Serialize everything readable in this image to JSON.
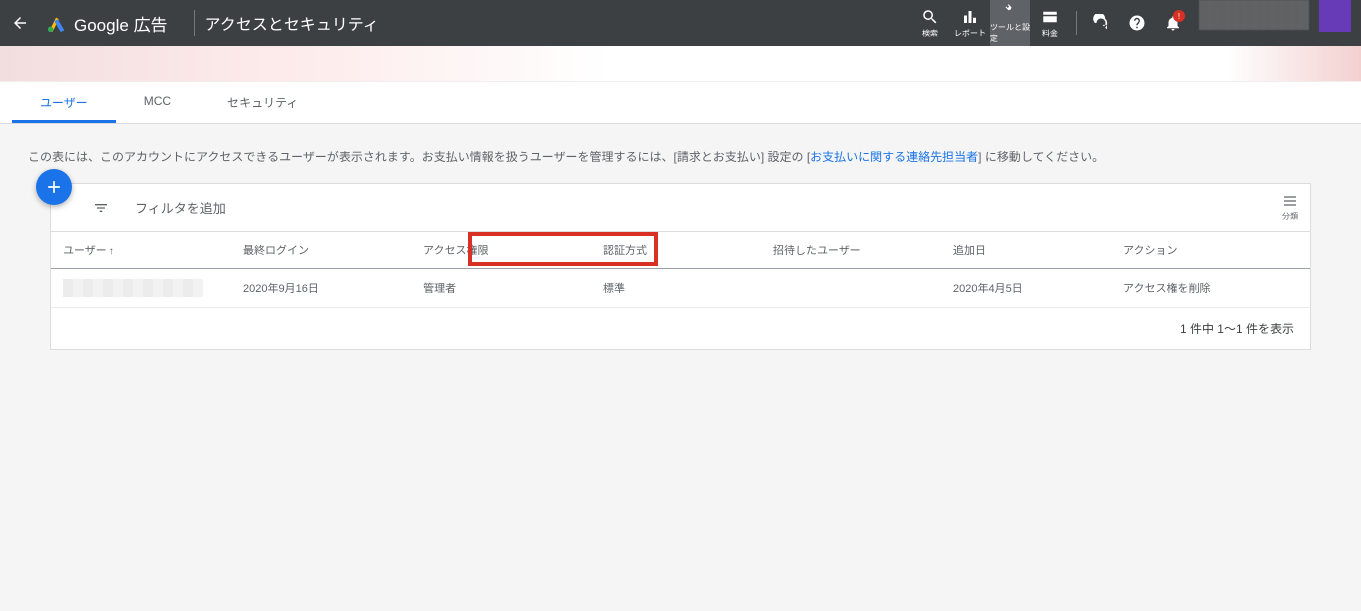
{
  "header": {
    "app_title": "Google 広告",
    "page_title": "アクセスとセキュリティ",
    "tools": {
      "search": "検索",
      "reports": "レポート",
      "tools_settings": "ツールと設定",
      "billing": "料金"
    },
    "notification_badge": "!"
  },
  "tabs": [
    {
      "label": "ユーザー",
      "active": true
    },
    {
      "label": "MCC",
      "active": false
    },
    {
      "label": "セキュリティ",
      "active": false
    }
  ],
  "info": {
    "prefix": "この表には、このアカウントにアクセスできるユーザーが表示されます。お支払い情報を扱うユーザーを管理するには、[請求とお支払い] 設定の [",
    "link": "お支払いに関する連絡先担当者",
    "suffix": "] に移動してください。"
  },
  "filter": {
    "label": "フィルタを追加",
    "segment_label": "分類"
  },
  "table": {
    "headers": {
      "user": "ユーザー",
      "last_login": "最終ログイン",
      "access_level": "アクセス権限",
      "auth_method": "認証方式",
      "invited_user": "招待したユーザー",
      "date_added": "追加日",
      "action": "アクション"
    },
    "rows": [
      {
        "user": "",
        "last_login": "2020年9月16日",
        "access_level": "管理者",
        "auth_method": "標準",
        "invited_user": "",
        "date_added": "2020年4月5日",
        "action": "アクセス権を削除"
      }
    ]
  },
  "pager": "1 件中 1～1 件を表示"
}
